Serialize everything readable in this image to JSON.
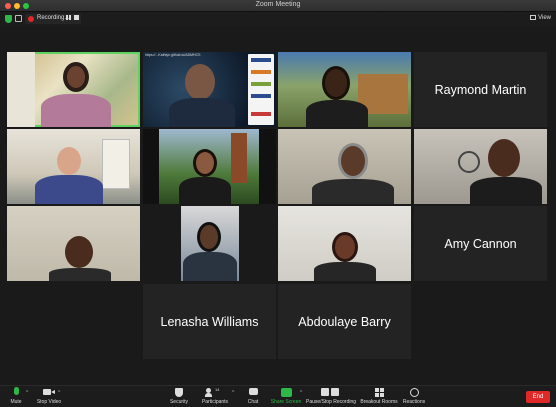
{
  "window": {
    "title": "Zoom Meeting"
  },
  "infobar": {
    "recording_label": "Recording...",
    "view_label": "View"
  },
  "tiles": {
    "r1c2_header": "https://...Kathlyn.github.io/ADMHCS",
    "r1c4_name": "Raymond Martin",
    "r3c4_name": "Amy Cannon",
    "r4c2_name": "Lenasha Williams",
    "r4c3_name": "Abdoulaye Barry"
  },
  "toolbar": {
    "mute": "Mute",
    "stop_video": "Stop Video",
    "security": "Security",
    "participants": "Participants",
    "participants_count": "14",
    "chat": "Chat",
    "share_screen": "Share Screen",
    "pause_stop_recording": "Pause/Stop Recording",
    "breakout_rooms": "Breakout Rooms",
    "reactions": "Reactions",
    "end": "End"
  },
  "colors": {
    "active_speaker": "#5fd35f",
    "end_button": "#e02828",
    "share_screen": "#2fb84a",
    "recording_dot": "#e02828"
  }
}
